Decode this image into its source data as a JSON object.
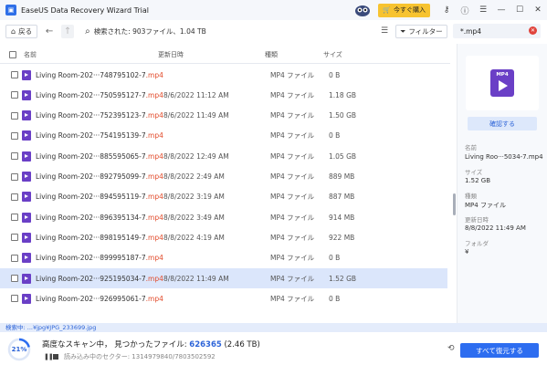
{
  "titlebar": {
    "app_title": "EaseUS Data Recovery Wizard Trial",
    "buy_label": "今すぐ購入",
    "icons": [
      "owl-mascot-icon",
      "cart-icon",
      "key-icon",
      "info-icon",
      "menu-icon",
      "minimize-icon",
      "maximize-icon",
      "close-icon"
    ]
  },
  "toolbar": {
    "back_label": "戻る",
    "search_info": "検索された: 903ファイル、1.04 TB",
    "filter_label": "フィルター",
    "search_value": "*.mp4"
  },
  "list": {
    "columns": {
      "name": "名前",
      "date": "更新日時",
      "type": "種類",
      "size": "サイズ"
    },
    "rows": [
      {
        "name": "Living Room-202···748795102-7",
        "ext": ".mp4",
        "date": "",
        "type": "MP4 ファイル",
        "size": "0 B"
      },
      {
        "name": "Living Room-202···750595127-7",
        "ext": ".mp4",
        "date": "8/6/2022 11:12 AM",
        "type": "MP4 ファイル",
        "size": "1.18 GB"
      },
      {
        "name": "Living Room-202···752395123-7",
        "ext": ".mp4",
        "date": "8/6/2022 11:49 AM",
        "type": "MP4 ファイル",
        "size": "1.50 GB"
      },
      {
        "name": "Living Room-202···754195139-7",
        "ext": ".mp4",
        "date": "",
        "type": "MP4 ファイル",
        "size": "0 B"
      },
      {
        "name": "Living Room-202···885595065-7",
        "ext": ".mp4",
        "date": "8/8/2022 12:49 AM",
        "type": "MP4 ファイル",
        "size": "1.05 GB"
      },
      {
        "name": "Living Room-202···892795099-7",
        "ext": ".mp4",
        "date": "8/8/2022 2:49 AM",
        "type": "MP4 ファイル",
        "size": "889 MB"
      },
      {
        "name": "Living Room-202···894595119-7",
        "ext": ".mp4",
        "date": "8/8/2022 3:19 AM",
        "type": "MP4 ファイル",
        "size": "887 MB"
      },
      {
        "name": "Living Room-202···896395134-7",
        "ext": ".mp4",
        "date": "8/8/2022 3:49 AM",
        "type": "MP4 ファイル",
        "size": "914 MB"
      },
      {
        "name": "Living Room-202···898195149-7",
        "ext": ".mp4",
        "date": "8/8/2022 4:19 AM",
        "type": "MP4 ファイル",
        "size": "922 MB"
      },
      {
        "name": "Living Room-202···899995187-7",
        "ext": ".mp4",
        "date": "",
        "type": "MP4 ファイル",
        "size": "0 B"
      },
      {
        "name": "Living Room-202···925195034-7",
        "ext": ".mp4",
        "date": "8/8/2022 11:49 AM",
        "type": "MP4 ファイル",
        "size": "1.52 GB"
      },
      {
        "name": "Living Room-202···926995061-7",
        "ext": ".mp4",
        "date": "",
        "type": "MP4 ファイル",
        "size": "0 B"
      }
    ]
  },
  "panel": {
    "preview_badge": "MP4",
    "confirm_label": "確認する",
    "name_label": "名前",
    "name_value": "Living Roo···5034-7.mp4",
    "size_label": "サイズ",
    "size_value": "1.52 GB",
    "type_label": "種類",
    "type_value": "MP4 ファイル",
    "modified_label": "更新日時",
    "modified_value": "8/8/2022 11:49 AM",
    "folder_label": "フォルダ",
    "folder_value": "¥"
  },
  "status": {
    "current_path": "検索中: ...¥jpg¥JPG_233699.jpg"
  },
  "footer": {
    "progress_percent": 21,
    "progress_label": "21%",
    "scan_prefix": "高度なスキャン中，  見つかったファイル: ",
    "found_count": "626365",
    "found_size": " (2.46 TB)",
    "sector_text": "読み込み中のセクター: 1314979840/7803502592",
    "recover_label": "すべて復元する"
  },
  "colors": {
    "accent": "#2d6df0",
    "selected_row": "#dbe6fb",
    "ext_red": "#e24b2b",
    "file_purple": "#6a3fc6"
  }
}
